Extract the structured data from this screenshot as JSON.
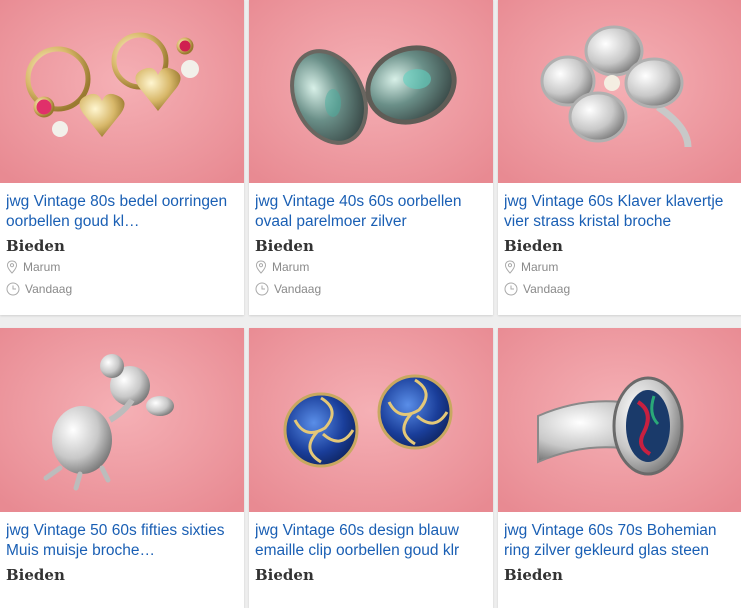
{
  "listings": [
    {
      "title": "jwg Vintage 80s bedel oorringen oorbellen goud kl…",
      "price": "Bieden",
      "location": "Marum",
      "date": "Vandaag",
      "image_icon": "gold-heart-charm-hoop-earrings-photo"
    },
    {
      "title": "jwg Vintage 40s 60s oorbellen ovaal parelmoer zilver",
      "price": "Bieden",
      "location": "Marum",
      "date": "Vandaag",
      "image_icon": "mother-of-pearl-oval-earrings-photo"
    },
    {
      "title": "jwg Vintage 60s Klaver klavertje vier strass kristal broche",
      "price": "Bieden",
      "location": "Marum",
      "date": "Vandaag",
      "image_icon": "four-leaf-clover-rhinestone-brooch-photo"
    },
    {
      "title": "jwg Vintage 50 60s fifties sixties Muis muisje broche…",
      "price": "Bieden",
      "location": "",
      "date": "",
      "image_icon": "silver-mouse-brooch-photo"
    },
    {
      "title": "jwg Vintage 60s design blauw emaille clip oorbellen goud klr",
      "price": "Bieden",
      "location": "",
      "date": "",
      "image_icon": "blue-enamel-clip-earrings-photo"
    },
    {
      "title": "jwg Vintage 60s 70s Bohemian ring zilver gekleurd glas steen",
      "price": "Bieden",
      "location": "",
      "date": "",
      "image_icon": "bohemian-silver-glass-stone-ring-photo"
    }
  ],
  "colors": {
    "link": "#1a5fb4",
    "meta": "#8a8a8a",
    "photo_bg": "#ef9aa0"
  }
}
